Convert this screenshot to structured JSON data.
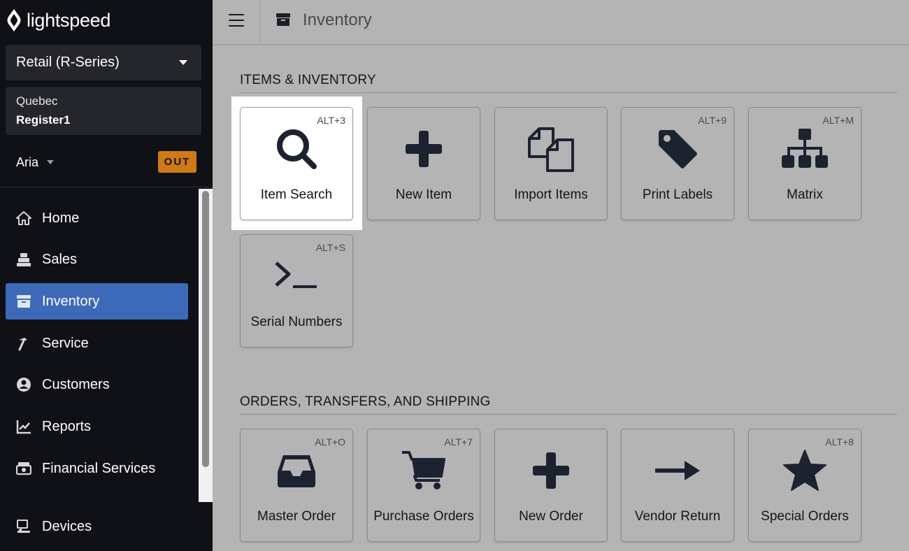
{
  "brand": {
    "name": "lightspeed"
  },
  "sidebar": {
    "product": "Retail (R-Series)",
    "shop": "Quebec",
    "register": "Register1",
    "user": "Aria",
    "status_badge": "OUT",
    "nav": [
      {
        "label": "Home",
        "icon": "home-icon"
      },
      {
        "label": "Sales",
        "icon": "register-icon"
      },
      {
        "label": "Inventory",
        "icon": "inventory-icon",
        "active": true
      },
      {
        "label": "Service",
        "icon": "hammer-icon"
      },
      {
        "label": "Customers",
        "icon": "customer-icon"
      },
      {
        "label": "Reports",
        "icon": "chart-icon"
      },
      {
        "label": "Financial Services",
        "icon": "cash-icon"
      },
      {
        "label": "Devices",
        "icon": "devices-icon"
      }
    ]
  },
  "header": {
    "title": "Inventory"
  },
  "sections": [
    {
      "title": "ITEMS & INVENTORY",
      "tiles": [
        {
          "label": "Item Search",
          "shortcut": "ALT+3",
          "icon": "search-icon",
          "selected": true
        },
        {
          "label": "New Item",
          "shortcut": "",
          "icon": "plus-icon"
        },
        {
          "label": "Import Items",
          "shortcut": "",
          "icon": "copy-icon"
        },
        {
          "label": "Print Labels",
          "shortcut": "ALT+9",
          "icon": "tag-icon"
        },
        {
          "label": "Matrix",
          "shortcut": "ALT+M",
          "icon": "sitemap-icon"
        },
        {
          "label": "Serial Numbers",
          "shortcut": "ALT+S",
          "icon": "terminal-icon"
        }
      ]
    },
    {
      "title": "ORDERS, TRANSFERS, AND SHIPPING",
      "tiles": [
        {
          "label": "Master Order",
          "shortcut": "ALT+O",
          "icon": "inbox-icon"
        },
        {
          "label": "Purchase Orders",
          "shortcut": "ALT+7",
          "icon": "cart-icon"
        },
        {
          "label": "New Order",
          "shortcut": "",
          "icon": "plus-icon"
        },
        {
          "label": "Vendor Return",
          "shortcut": "",
          "icon": "arrow-right-icon"
        },
        {
          "label": "Special Orders",
          "shortcut": "ALT+8",
          "icon": "star-icon"
        }
      ]
    }
  ]
}
